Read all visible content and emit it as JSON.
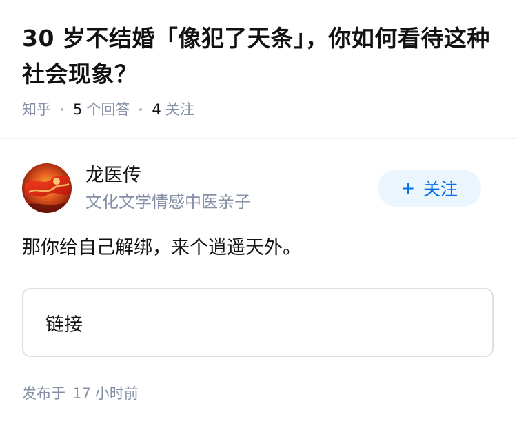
{
  "question": {
    "title": "30 岁不结婚「像犯了天条」，你如何看待这种社会现象？",
    "source": "知乎",
    "answers_count": "5",
    "answers_label": "个回答",
    "followers_count": "4",
    "followers_label": "关注"
  },
  "answer": {
    "author": {
      "name": "龙医传",
      "bio": "文化文学情感中医亲子",
      "avatar_icon": "dragon-avatar"
    },
    "follow_button": {
      "icon": "plus-icon",
      "label": "关注",
      "color": "#056de8",
      "background": "#ebf5fd"
    },
    "content": "那你给自己解绑，来个逍遥天外。",
    "link_card": {
      "label": "链接"
    },
    "publish": {
      "prefix": "发布于",
      "number": "17",
      "suffix": "小时前"
    }
  }
}
